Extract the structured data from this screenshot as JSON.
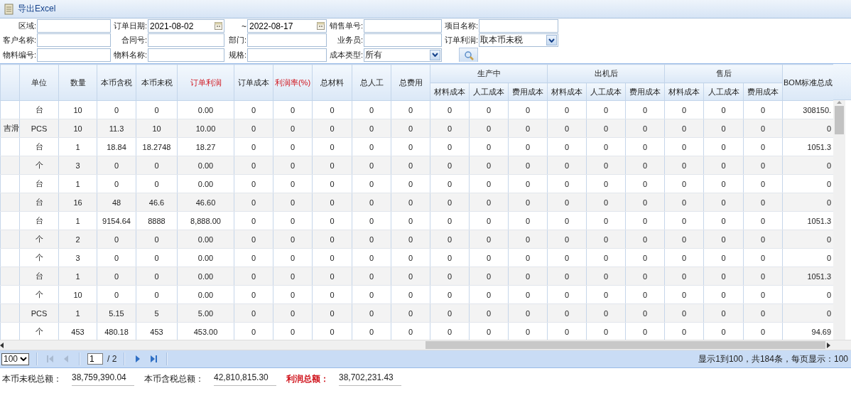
{
  "window": {
    "title": "导出Excel"
  },
  "filters": [
    [
      {
        "label": "区域:",
        "kind": "text"
      },
      {
        "label": "订单日期:",
        "kind": "daterange",
        "from": "2021-08-02",
        "separator": "~",
        "to": "2022-08-17"
      },
      {
        "label": "销售单号:",
        "kind": "text"
      },
      {
        "label": "项目名称:",
        "kind": "text"
      }
    ],
    [
      {
        "label": "客户名称:",
        "kind": "text"
      },
      {
        "label": "合同号:",
        "kind": "text"
      },
      {
        "label": "部门:",
        "kind": "text"
      },
      {
        "label": "业务员:",
        "kind": "text"
      },
      {
        "label": "订单利润:",
        "kind": "select",
        "value": "取本币未税"
      }
    ],
    [
      {
        "label": "物料编号:",
        "kind": "text"
      },
      {
        "label": "物料名称:",
        "kind": "text"
      },
      {
        "label": "规格:",
        "kind": "text"
      },
      {
        "label": "成本类型:",
        "kind": "select",
        "value": "所有"
      },
      {
        "kind": "search"
      }
    ]
  ],
  "table": {
    "columns": [
      {
        "kind": "column"
      },
      {
        "kind": "column",
        "label": "单位",
        "highlight": false
      },
      {
        "kind": "column",
        "label": "数量",
        "highlight": false
      },
      {
        "kind": "column",
        "label": "本币含税",
        "highlight": false
      },
      {
        "kind": "column",
        "label": "本币未税",
        "highlight": false
      },
      {
        "kind": "column",
        "label": "订单利润",
        "highlight": true
      },
      {
        "kind": "column",
        "label": "订单成本",
        "highlight": false
      },
      {
        "kind": "column",
        "label": "利润率(%)",
        "highlight": true
      },
      {
        "kind": "column",
        "label": "总材料",
        "highlight": false
      },
      {
        "kind": "column",
        "label": "总人工",
        "highlight": false
      },
      {
        "kind": "column",
        "label": "总费用",
        "highlight": false
      },
      {
        "kind": "group",
        "label": "生产中",
        "colspan": 3,
        "children": [
          "材料成本",
          "人工成本",
          "费用成本"
        ]
      },
      {
        "kind": "group",
        "label": "出机后",
        "colspan": 3,
        "children": [
          "材料成本",
          "人工成本",
          "费用成本"
        ]
      },
      {
        "kind": "group",
        "label": "售后",
        "colspan": 3,
        "children": [
          "材料成本",
          "人工成本",
          "费用成本"
        ]
      },
      {
        "kind": "column",
        "label": "BOM标准总成",
        "highlight": false
      }
    ],
    "rows": [
      {
        "cells": [
          "",
          "台",
          "10",
          "0",
          "0",
          "0.00",
          "0",
          "0",
          "0",
          "0",
          "0",
          "0",
          "0",
          "0",
          "0",
          "0",
          "0",
          "0",
          "0",
          "0",
          "308150."
        ]
      },
      {
        "cells": [
          "吉滑",
          "PCS",
          "10",
          "11.3",
          "10",
          "10.00",
          "0",
          "0",
          "0",
          "0",
          "0",
          "0",
          "0",
          "0",
          "0",
          "0",
          "0",
          "0",
          "0",
          "0",
          "0"
        ]
      },
      {
        "cells": [
          "",
          "台",
          "1",
          "18.84",
          "18.2748",
          "18.27",
          "0",
          "0",
          "0",
          "0",
          "0",
          "0",
          "0",
          "0",
          "0",
          "0",
          "0",
          "0",
          "0",
          "0",
          "1051.3"
        ]
      },
      {
        "cells": [
          "",
          "个",
          "3",
          "0",
          "0",
          "0.00",
          "0",
          "0",
          "0",
          "0",
          "0",
          "0",
          "0",
          "0",
          "0",
          "0",
          "0",
          "0",
          "0",
          "0",
          "0"
        ]
      },
      {
        "cells": [
          "",
          "台",
          "1",
          "0",
          "0",
          "0.00",
          "0",
          "0",
          "0",
          "0",
          "0",
          "0",
          "0",
          "0",
          "0",
          "0",
          "0",
          "0",
          "0",
          "0",
          "0"
        ]
      },
      {
        "cells": [
          "",
          "台",
          "16",
          "48",
          "46.6",
          "46.60",
          "0",
          "0",
          "0",
          "0",
          "0",
          "0",
          "0",
          "0",
          "0",
          "0",
          "0",
          "0",
          "0",
          "0",
          "0"
        ]
      },
      {
        "cells": [
          "",
          "台",
          "1",
          "9154.64",
          "8888",
          "8,888.00",
          "0",
          "0",
          "0",
          "0",
          "0",
          "0",
          "0",
          "0",
          "0",
          "0",
          "0",
          "0",
          "0",
          "0",
          "1051.3"
        ]
      },
      {
        "cells": [
          "",
          "个",
          "2",
          "0",
          "0",
          "0.00",
          "0",
          "0",
          "0",
          "0",
          "0",
          "0",
          "0",
          "0",
          "0",
          "0",
          "0",
          "0",
          "0",
          "0",
          "0"
        ]
      },
      {
        "cells": [
          "",
          "个",
          "3",
          "0",
          "0",
          "0.00",
          "0",
          "0",
          "0",
          "0",
          "0",
          "0",
          "0",
          "0",
          "0",
          "0",
          "0",
          "0",
          "0",
          "0",
          "0"
        ]
      },
      {
        "cells": [
          "",
          "台",
          "1",
          "0",
          "0",
          "0.00",
          "0",
          "0",
          "0",
          "0",
          "0",
          "0",
          "0",
          "0",
          "0",
          "0",
          "0",
          "0",
          "0",
          "0",
          "1051.3"
        ]
      },
      {
        "cells": [
          "",
          "个",
          "10",
          "0",
          "0",
          "0.00",
          "0",
          "0",
          "0",
          "0",
          "0",
          "0",
          "0",
          "0",
          "0",
          "0",
          "0",
          "0",
          "0",
          "0",
          "0"
        ]
      },
      {
        "cells": [
          "",
          "PCS",
          "1",
          "5.15",
          "5",
          "5.00",
          "0",
          "0",
          "0",
          "0",
          "0",
          "0",
          "0",
          "0",
          "0",
          "0",
          "0",
          "0",
          "0",
          "0",
          "0"
        ]
      },
      {
        "cells": [
          "",
          "个",
          "453",
          "480.18",
          "453",
          "453.00",
          "0",
          "0",
          "0",
          "0",
          "0",
          "0",
          "0",
          "0",
          "0",
          "0",
          "0",
          "0",
          "0",
          "0",
          "94.69"
        ]
      }
    ]
  },
  "pager": {
    "page_size": "100",
    "page": "1",
    "pages": "/ 2",
    "buttons": [
      {
        "kind": "first",
        "disabled": true
      },
      {
        "kind": "prev",
        "disabled": true
      },
      {
        "kind": "next",
        "disabled": false
      },
      {
        "kind": "last",
        "disabled": false
      }
    ],
    "info": "显示1到100，共184条，每页显示：100"
  },
  "totals": [
    {
      "label": "本币未税总额：",
      "value": "38,759,390.04",
      "highlight": false
    },
    {
      "label": "本币含税总额：",
      "value": "42,810,815.30",
      "highlight": false
    },
    {
      "label": "利润总额：",
      "value": "38,702,231.43",
      "highlight": true
    }
  ]
}
